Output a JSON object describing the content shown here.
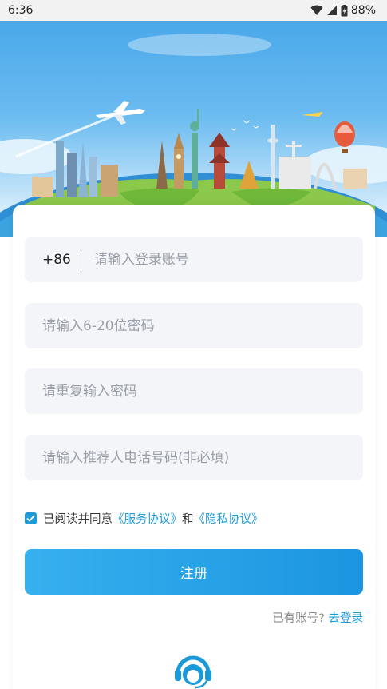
{
  "status_bar": {
    "time": "6:36",
    "battery": "88%",
    "icons": [
      "wifi-icon",
      "signal-icon",
      "battery-icon"
    ]
  },
  "form": {
    "country_code": "+86",
    "account_placeholder": "请输入登录账号",
    "password_placeholder": "请输入6-20位密码",
    "confirm_password_placeholder": "请重复输入密码",
    "referrer_placeholder": "请输入推荐人电话号码(非必填)"
  },
  "agreement": {
    "checked": true,
    "prefix": "已阅读并同意",
    "service_link": "《服务协议》",
    "and": "和",
    "privacy_link": "《隐私协议》"
  },
  "register_button": "注册",
  "login_prompt": {
    "text": "已有账号?",
    "link": "去登录"
  },
  "colors": {
    "accent": "#1a9ad8",
    "button_start": "#37b0ef",
    "button_end": "#1b95e0",
    "field_bg": "#f3f5f9"
  }
}
